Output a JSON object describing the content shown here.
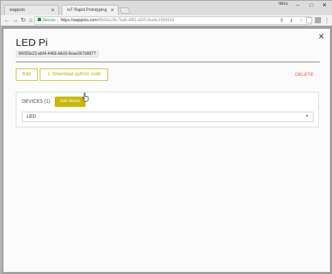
{
  "browser": {
    "tabs": [
      {
        "title": "wappsto",
        "active": false
      },
      {
        "title": "IoT Rapid Prototyping",
        "active": true
      }
    ],
    "profile_name": "Ibliss",
    "window_controls": {
      "minimize": "–",
      "maximize": "□",
      "close": "✕"
    },
    "security_label": "Secure",
    "url_host": "https://wappsto.com",
    "url_path": "/65d3a106-7ba5-4f92-af20-4ce4c1593918",
    "icons": [
      "back-icon",
      "forward-icon",
      "reload-icon",
      "home-icon",
      "lock-icon",
      "search-icon",
      "key-icon",
      "star-icon",
      "extension-icon",
      "menu-icon"
    ]
  },
  "modal": {
    "title": "LED Pi",
    "uuid": "86055e23-ebf4-4466-b6d3-6eae367d8977",
    "actions": {
      "edit": "Edit",
      "download": "Download python code",
      "delete": "DELETE"
    },
    "devices": {
      "label": "DEVICES (1)",
      "add_button": "Add device",
      "selected": "LED"
    }
  },
  "colors": {
    "accent": "#c8b900",
    "outline": "#c9bf2a",
    "delete": "#e0664e",
    "secure": "#1e8e3e"
  }
}
